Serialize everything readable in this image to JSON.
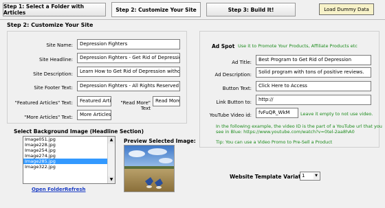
{
  "tabs": [
    {
      "label": "Step 1: Select a Folder with Articles"
    },
    {
      "label": "Step 2: Customize Your Site"
    },
    {
      "label": "Step 3: Build It!"
    }
  ],
  "load_dummy_label": "Load Dummy Data",
  "section_title": "Step 2: Customize Your Site",
  "site": {
    "name_label": "Site Name:",
    "name_value": "Depression Fighters",
    "headline_label": "Site Headline:",
    "headline_value": "Depression Fighters - Get Rid of Depression",
    "description_label": "Site Description:",
    "description_value": "Learn How to Get Rid of Depression without Pills!",
    "footer_label": "Site Footer Text:",
    "footer_value": "Depression Fighters - All Rights Reserved",
    "featured_label": "\"Featured Articles\" Text:",
    "featured_value": "Featured Articles",
    "readmore_label": "\"Read More\" Text",
    "readmore_value": "Read More",
    "more_label": "\"More Articles\" Text:",
    "more_value": "More Articles"
  },
  "bg": {
    "heading": "Select Background Image (Headline Section)",
    "items": [
      "Image051.jpg",
      "Image228.jpg",
      "Image254.jpg",
      "Image274.jpg",
      "Image285.jpg",
      "Image322.jpg"
    ],
    "selected_index": 4,
    "open_folder": "Open Folder",
    "refresh": "Refresh",
    "preview_heading": "Preview Selected Image:"
  },
  "ad": {
    "title": "Ad Spot",
    "subtitle": "Use it to Promote Your Products, Affiliate Products etc",
    "ad_title_label": "Ad Title:",
    "ad_title_value": "Best Program to Get Rid of Depression",
    "ad_desc_label": "Ad Description:",
    "ad_desc_value": "Solid program with tons of positive reviews.",
    "button_label": "Button Text:",
    "button_value": "Click Here to Access",
    "link_label": "Link Button to:",
    "link_value": "http://",
    "video_label": "YouTube Video id:",
    "video_value": "fvFuQR_WkM",
    "video_hint": "Leave it empty to not use video.",
    "example_line1": "In the following example, the video ID is the part of a YouTube url that you",
    "example_line2": "see in Blue:  https://www.youtube.com/watch?v=0tel-2aa8hA0",
    "tip": "Tip: You can use a Video Promo to Pre-Sell a Product"
  },
  "template": {
    "label": "Website Template Variation:",
    "value": "1"
  },
  "colors": {
    "selection": "#3399ff",
    "link": "#1a3cc4",
    "hint_green": "#1a8a1a",
    "dummy_button": "#f7f2c9"
  }
}
